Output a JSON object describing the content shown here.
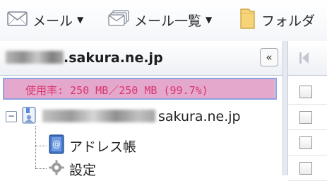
{
  "toolbar": {
    "mail_label": "メール",
    "mail_list_label": "メール一覧",
    "folder_label": "フォルダ"
  },
  "account": {
    "domain_suffix": ".sakura.ne.jp",
    "collapse_symbol": "«"
  },
  "quota": {
    "text": "使用率: 250 MB／250 MB (99.7%)",
    "percent": 99.7
  },
  "tree": {
    "account_domain": "sakura.ne.jp",
    "items": [
      {
        "label": "アドレス帳"
      },
      {
        "label": "設定"
      }
    ]
  },
  "message_list": {
    "visible_rows": 4
  },
  "colors": {
    "quota_text": "#d9356e",
    "quota_bg": "#d7dcf7",
    "quota_border": "#8ea1e0"
  }
}
